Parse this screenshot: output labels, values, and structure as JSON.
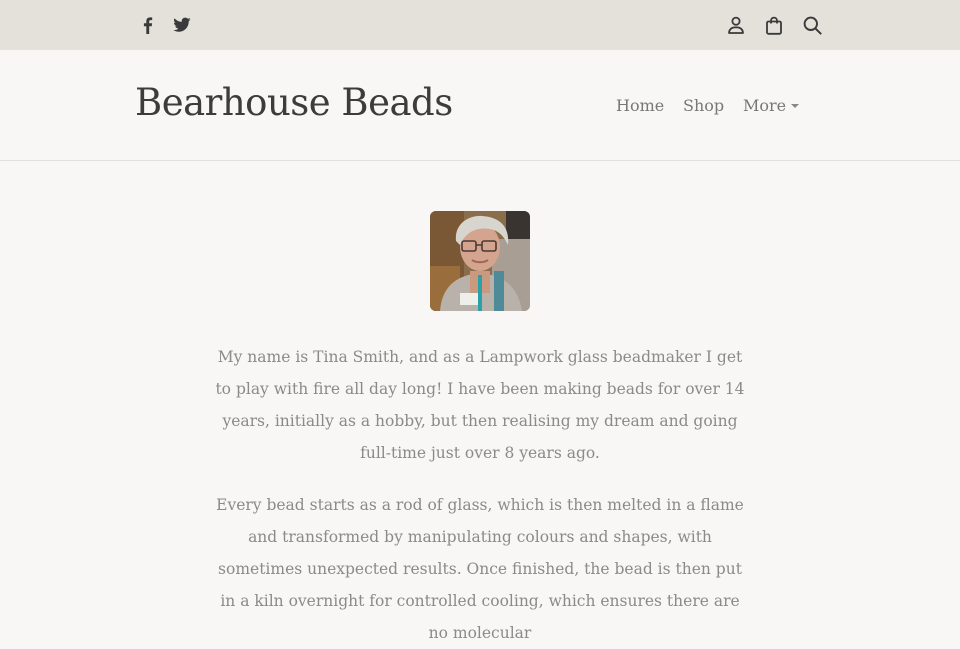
{
  "topbar": {
    "social": [
      {
        "icon": "facebook-icon"
      },
      {
        "icon": "twitter-icon"
      }
    ],
    "actions": [
      {
        "icon": "account-icon"
      },
      {
        "icon": "shopping-bag-icon"
      },
      {
        "icon": "search-icon"
      }
    ],
    "icon_color": "#3a3a3a",
    "background": "#e4e1db"
  },
  "header": {
    "brand": "Bearhouse Beads",
    "nav": {
      "home": "Home",
      "shop": "Shop",
      "more": "More"
    }
  },
  "main": {
    "avatar": {
      "icon": "profile-photo"
    },
    "paragraphs": [
      "My name is Tina Smith, and as a Lampwork glass beadmaker I get to play with fire all day long! I have been making beads for over 14 years, initially as a hobby, but then realising my dream and going full-time just over 8 years ago.",
      "Every bead starts as a rod of glass, which is then melted in a flame and transformed by manipulating colours and shapes, with sometimes unexpected results. Once finished, the bead is then put in a kiln overnight for controlled cooling, which ensures there are no molecular"
    ]
  },
  "colors": {
    "page_background": "#f8f7f5",
    "text_muted": "#8a8a8a",
    "brand_text": "#3c3c3c"
  }
}
